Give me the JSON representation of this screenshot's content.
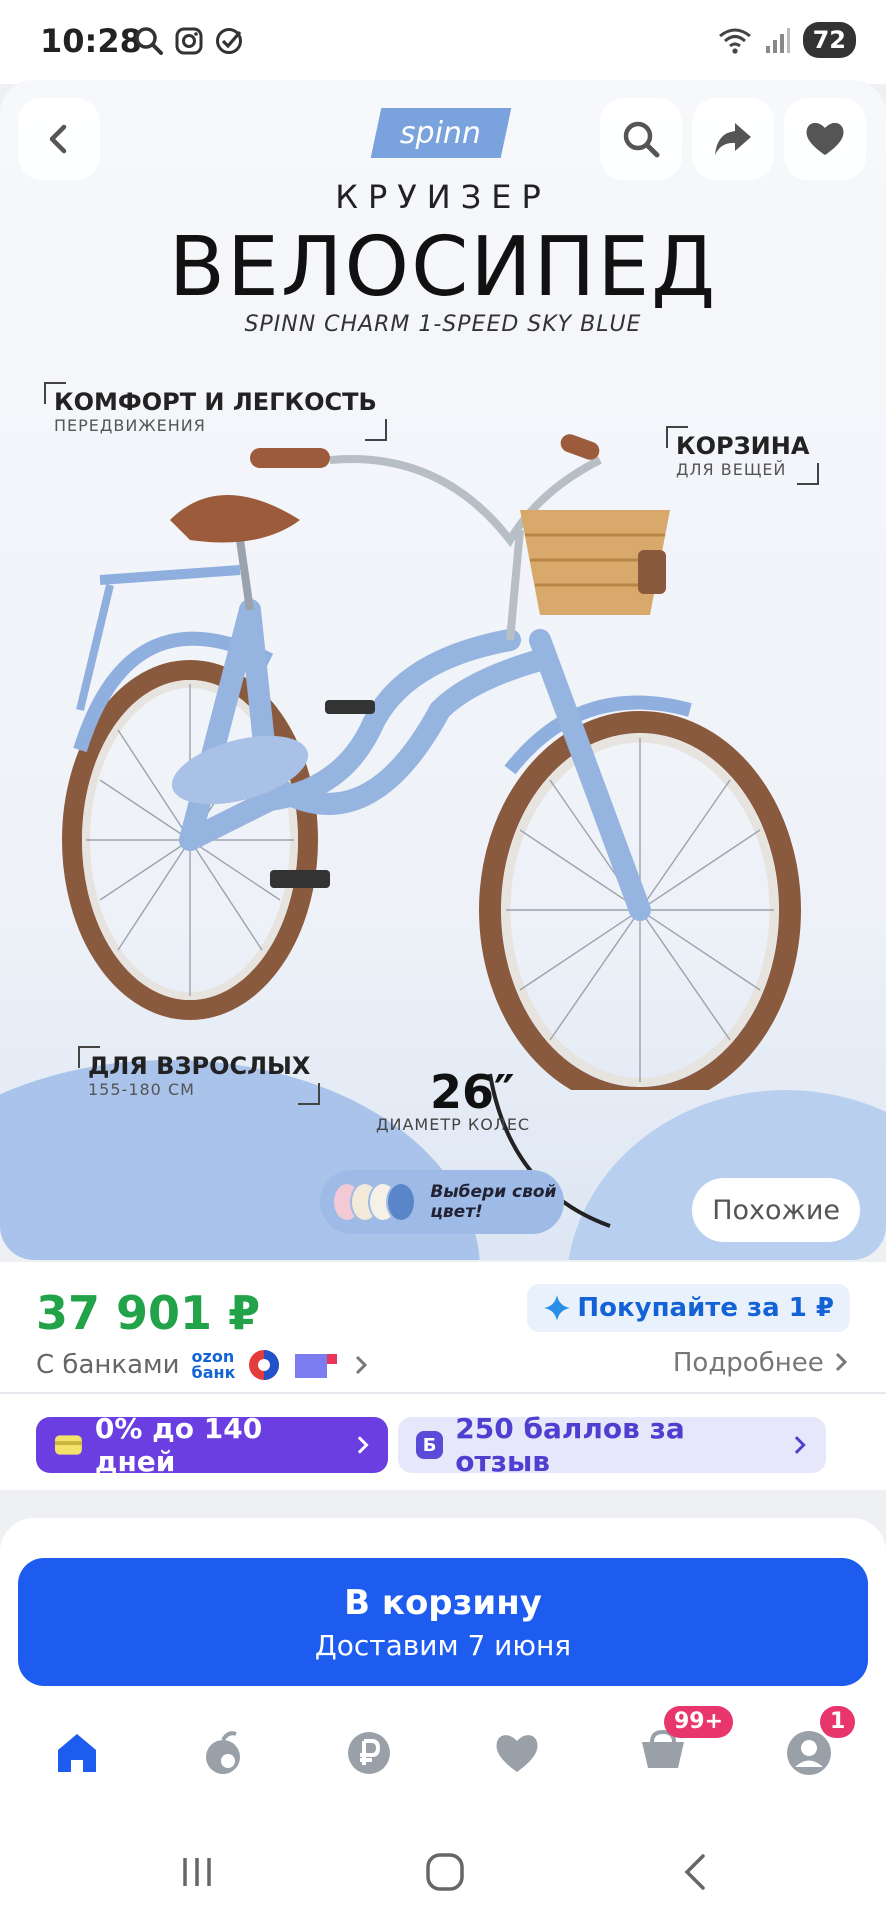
{
  "status_bar": {
    "time": "10:28",
    "battery": "72",
    "icons": [
      "search-icon",
      "instagram-icon",
      "check-circle-icon",
      "wifi-icon",
      "signal-icon"
    ]
  },
  "hero": {
    "brand": "spinn",
    "title_small": "КРУИЗЕР",
    "title_big": "ВЕЛОСИПЕД",
    "model": "SPINN CHARM 1-SPEED SKY BLUE",
    "callouts": {
      "comfort_main": "КОМФОРТ И ЛЕГКОСТЬ",
      "comfort_sub": "ПЕРЕДВИЖЕНИЯ",
      "basket_main": "КОРЗИНА",
      "basket_sub": "ДЛЯ ВЕЩЕЙ",
      "adults_main": "ДЛЯ ВЗРОСЛЫХ",
      "adults_sub": "155-180 СМ"
    },
    "wheel_size": "26″",
    "wheel_sub": "ДИАМЕТР КОЛЕС",
    "color_choose": "Выбери свой цвет!",
    "color_dots": [
      "#f3c9d6",
      "#f3ead9",
      "#f6f1e6",
      "#5a86c9"
    ],
    "similar": "Похожие"
  },
  "price": {
    "value": "37 901 ₽",
    "buy_for": "Покупайте за 1 ₽",
    "banks_label": "С банками",
    "ozon_bank_line1": "ozon",
    "ozon_bank_line2": "банк",
    "more": "Подробнее"
  },
  "promos": {
    "installment": "0% до 140 дней",
    "points_badge": "Б",
    "points": "250 баллов за отзыв"
  },
  "cart": {
    "label": "В корзину",
    "delivery": "Доставим 7 июня"
  },
  "tabbar": {
    "items": [
      "home-icon",
      "fresh-icon",
      "ruble-icon",
      "heart-icon",
      "cart-icon",
      "profile-icon"
    ],
    "cart_badge": "99+",
    "profile_badge": "1"
  },
  "colors": {
    "price_green": "#22a34a",
    "primary_blue": "#1e5cf0",
    "installment_purple": "#6a3ee0"
  }
}
